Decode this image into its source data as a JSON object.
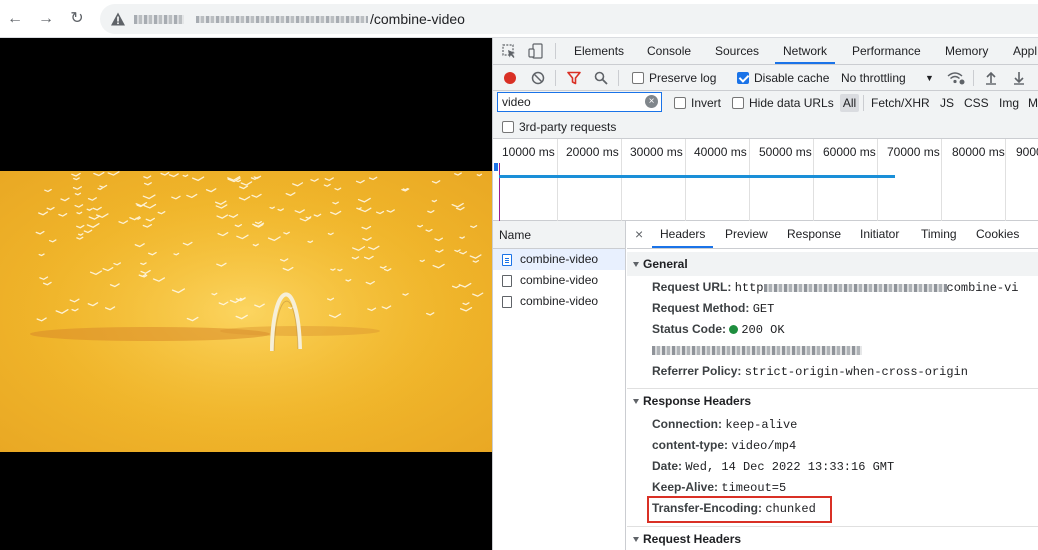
{
  "browser": {
    "url_path": "/combine-video",
    "security_icon": "warning-triangle-icon"
  },
  "devtools": {
    "tabs": [
      "Elements",
      "Console",
      "Sources",
      "Network",
      "Performance",
      "Memory",
      "Appl"
    ],
    "active_tab": "Network",
    "toolbar": {
      "preserve_log": "Preserve log",
      "disable_cache": "Disable cache",
      "throttling": "No throttling"
    },
    "filter": {
      "value": "video",
      "invert": "Invert",
      "hide_data_urls": "Hide data URLs",
      "types": [
        "All",
        "Fetch/XHR",
        "JS",
        "CSS",
        "Img",
        "M"
      ],
      "third_party": "3rd-party requests"
    },
    "timeline": {
      "ticks": [
        "10000 ms",
        "20000 ms",
        "30000 ms",
        "40000 ms",
        "50000 ms",
        "60000 ms",
        "70000 ms",
        "80000 ms",
        "9000"
      ]
    },
    "requests": {
      "header": "Name",
      "rows": [
        "combine-video",
        "combine-video",
        "combine-video"
      ]
    },
    "details": {
      "tabs": [
        "Headers",
        "Preview",
        "Response",
        "Initiator",
        "Timing",
        "Cookies"
      ],
      "active_tab": "Headers",
      "general": {
        "title": "General",
        "request_url_key": "Request URL:",
        "request_url_start": "http",
        "request_url_end": "combine-vi",
        "request_method_key": "Request Method:",
        "request_method_val": "GET",
        "status_code_key": "Status Code:",
        "status_code_val": "200 OK",
        "referrer_policy_key": "Referrer Policy:",
        "referrer_policy_val": "strict-origin-when-cross-origin"
      },
      "response_headers": {
        "title": "Response Headers",
        "connection_key": "Connection:",
        "connection_val": "keep-alive",
        "content_type_key": "content-type:",
        "content_type_val": "video/mp4",
        "date_key": "Date:",
        "date_val": "Wed, 14 Dec 2022 13:33:16 GMT",
        "keep_alive_key": "Keep-Alive:",
        "keep_alive_val": "timeout=5",
        "transfer_encoding_key": "Transfer-Encoding:",
        "transfer_encoding_val": "chunked"
      },
      "request_headers": {
        "title": "Request Headers"
      }
    },
    "colors": {
      "accent": "#1a73e8",
      "record": "#d93025",
      "status_ok": "#1e8e3e",
      "highlight": "#d93025"
    }
  }
}
